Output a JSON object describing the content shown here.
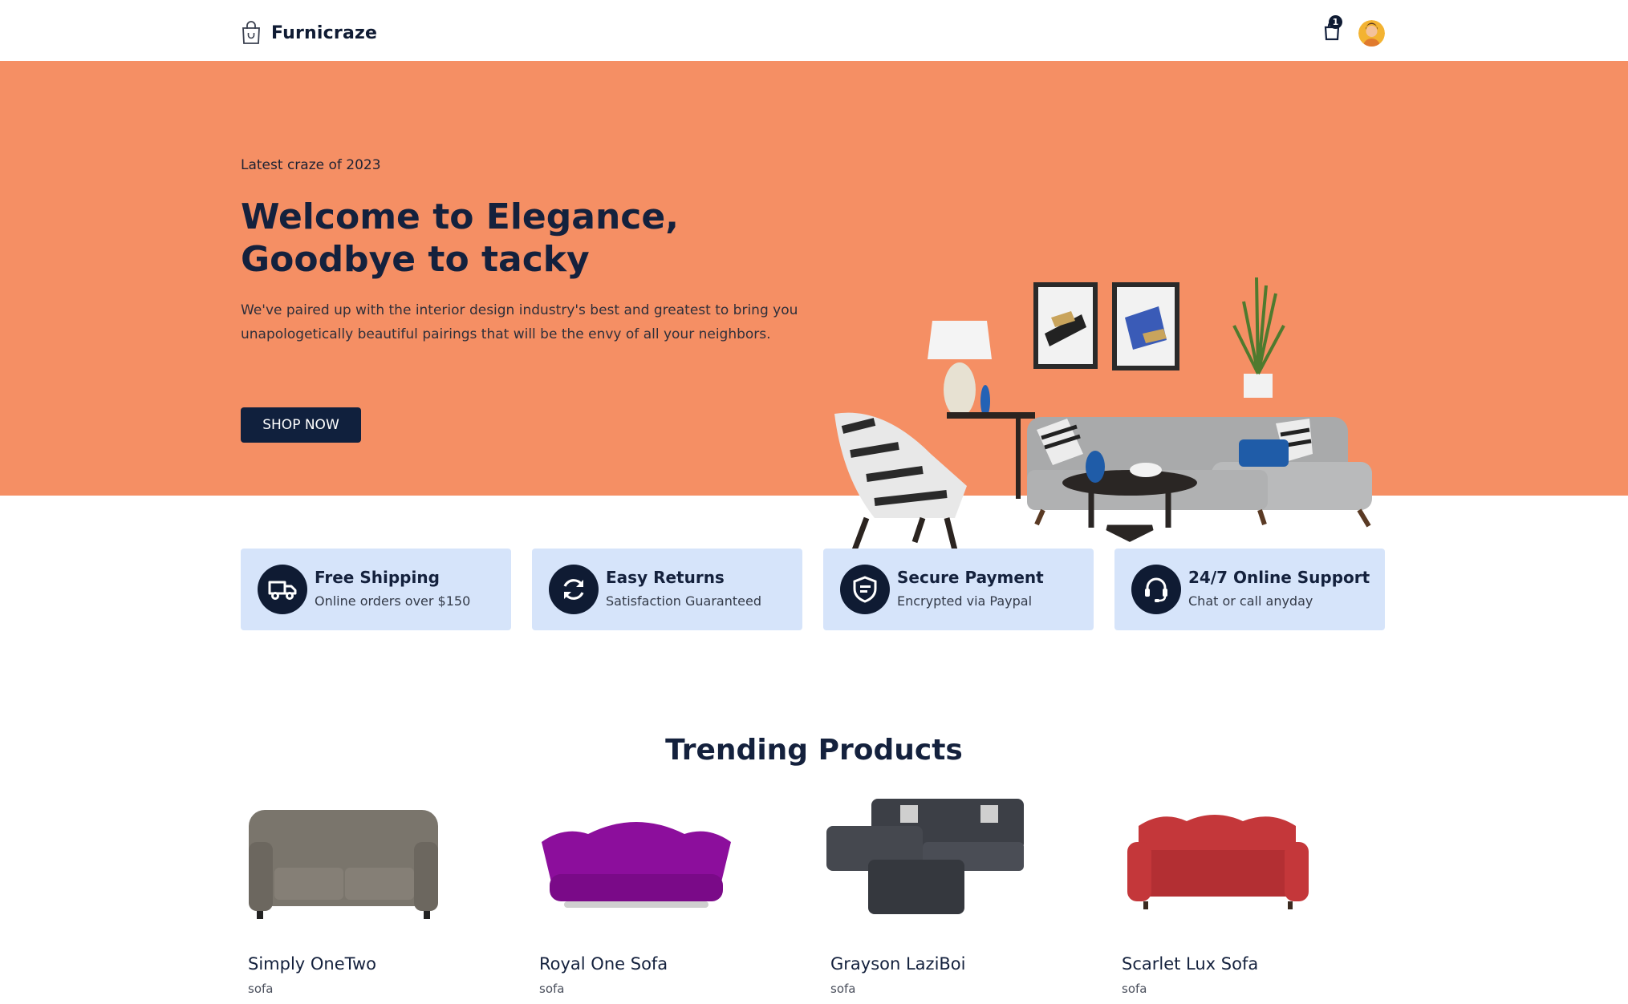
{
  "nav": {
    "brand": "Furnicraze",
    "cart_count": "1",
    "icons": [
      "shopping-bag-icon",
      "cart-icon",
      "user-avatar"
    ]
  },
  "hero": {
    "eyebrow": "Latest craze of 2023",
    "headline_line1": "Welcome to Elegance,",
    "headline_line2": "Goodbye to tacky",
    "description": "We've paired up with the interior design industry's best and greatest to bring you unapologetically beautiful pairings that will be the envy of all your neighbors.",
    "cta_label": "SHOP NOW",
    "background_color": "#f58f64"
  },
  "features": [
    {
      "title": "Free Shipping",
      "subtitle": "Online orders over $150",
      "icon": "truck-icon"
    },
    {
      "title": "Easy Returns",
      "subtitle": "Satisfaction Guaranteed",
      "icon": "refresh-icon"
    },
    {
      "title": "Secure Payment",
      "subtitle": "Encrypted via Paypal",
      "icon": "shield-icon"
    },
    {
      "title": "24/7 Online Support",
      "subtitle": "Chat or call anyday",
      "icon": "headset-icon"
    }
  ],
  "trending": {
    "title": "Trending Products",
    "products": [
      {
        "name": "Simply OneTwo",
        "category": "sofa",
        "color": "#7a756c"
      },
      {
        "name": "Royal One Sofa",
        "category": "sofa",
        "color": "#8c0e9c"
      },
      {
        "name": "Grayson LaziBoi",
        "category": "sofa",
        "color": "#3c3f46"
      },
      {
        "name": "Scarlet Lux Sofa",
        "category": "sofa",
        "color": "#c4373a"
      }
    ]
  },
  "colors": {
    "navy": "#0f1b33",
    "feature_bg": "#d6e4fa"
  }
}
